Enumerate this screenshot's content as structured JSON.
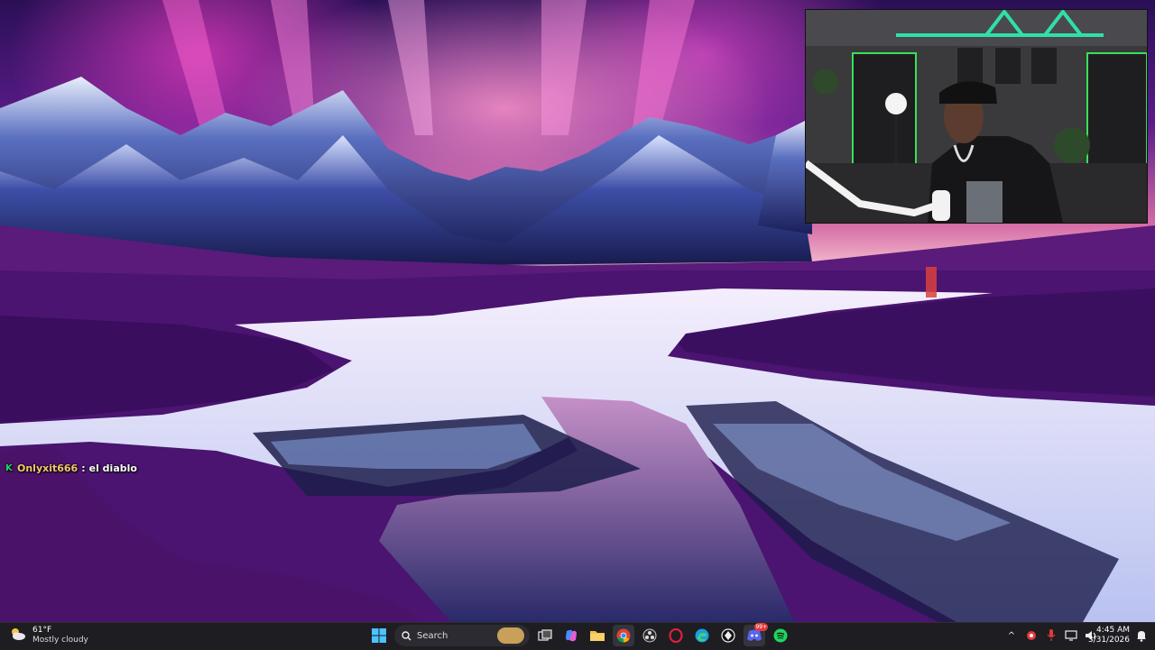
{
  "stream_chat": {
    "username": "Onlyxit666",
    "separator": ":",
    "message": "el diablo"
  },
  "taskbar": {
    "weather": {
      "temp": "61°F",
      "condition": "Mostly cloudy",
      "icon": "cloud-sun-icon"
    },
    "search": {
      "label": "Search"
    },
    "pinned_apps": [
      {
        "name": "task-view",
        "icon": "task-view-icon"
      },
      {
        "name": "copilot",
        "icon": "copilot-icon"
      },
      {
        "name": "file-explorer",
        "icon": "folder-icon"
      },
      {
        "name": "chrome",
        "icon": "chrome-icon"
      },
      {
        "name": "obs",
        "icon": "obs-icon"
      },
      {
        "name": "opera-gx",
        "icon": "opera-gx-icon"
      },
      {
        "name": "edge",
        "icon": "edge-icon"
      },
      {
        "name": "cursor",
        "icon": "cursor-icon"
      },
      {
        "name": "discord",
        "icon": "discord-icon",
        "badge": "99+"
      },
      {
        "name": "spotify",
        "icon": "spotify-icon"
      }
    ],
    "tray": {
      "time": "4:45 AM",
      "date": "3/31/2026"
    }
  },
  "colors": {
    "taskbar_bg": "#1d1d22",
    "accent_green": "#1bd96a",
    "chat_user": "#f2c86b"
  }
}
